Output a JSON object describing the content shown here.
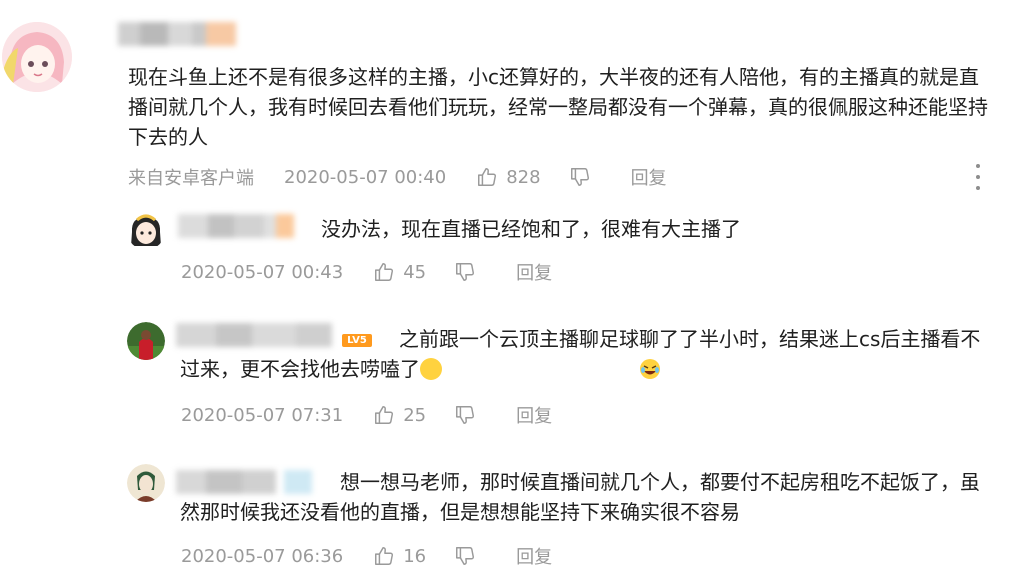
{
  "main_comment": {
    "text": "现在斗鱼上还不是有很多这样的主播，小c还算好的，大半夜的还有人陪他，有的主播真的就是直播间就几个人，我有时候回去看他们玩玩，经常一整局都没有一个弹幕，真的很佩服这种还能坚持下去的人",
    "source": "来自安卓客户端",
    "timestamp": "2020-05-07 00:40",
    "likes": "828",
    "reply_label": "回复",
    "more_icon": "more-vertical-icon"
  },
  "replies": [
    {
      "text": "没办法，现在直播已经饱和了，很难有大主播了",
      "timestamp": "2020-05-07 00:43",
      "likes": "45",
      "reply_label": "回复",
      "badge": ""
    },
    {
      "text": "之前跟一个云顶主播聊足球聊了了半小时，结果迷上cs后主播看不过来，更不会找他去唠嗑了",
      "timestamp": "2020-05-07 07:31",
      "likes": "25",
      "reply_label": "回复",
      "badge": "LV5"
    },
    {
      "text": "想一想马老师，那时候直播间就几个人，都要付不起房租吃不起饭了，虽然那时候我还没看他的直播，但是想想能坚持下来确实很不容易",
      "timestamp": "2020-05-07 06:36",
      "likes": "16",
      "reply_label": "回复",
      "badge": ""
    }
  ],
  "icons": {
    "like": "thumbs-up-icon",
    "dislike": "thumbs-down-icon"
  },
  "colors": {
    "meta_gray": "#9a9a9a",
    "text": "#1f1f1f",
    "badge_orange": "#ff9a1e"
  }
}
